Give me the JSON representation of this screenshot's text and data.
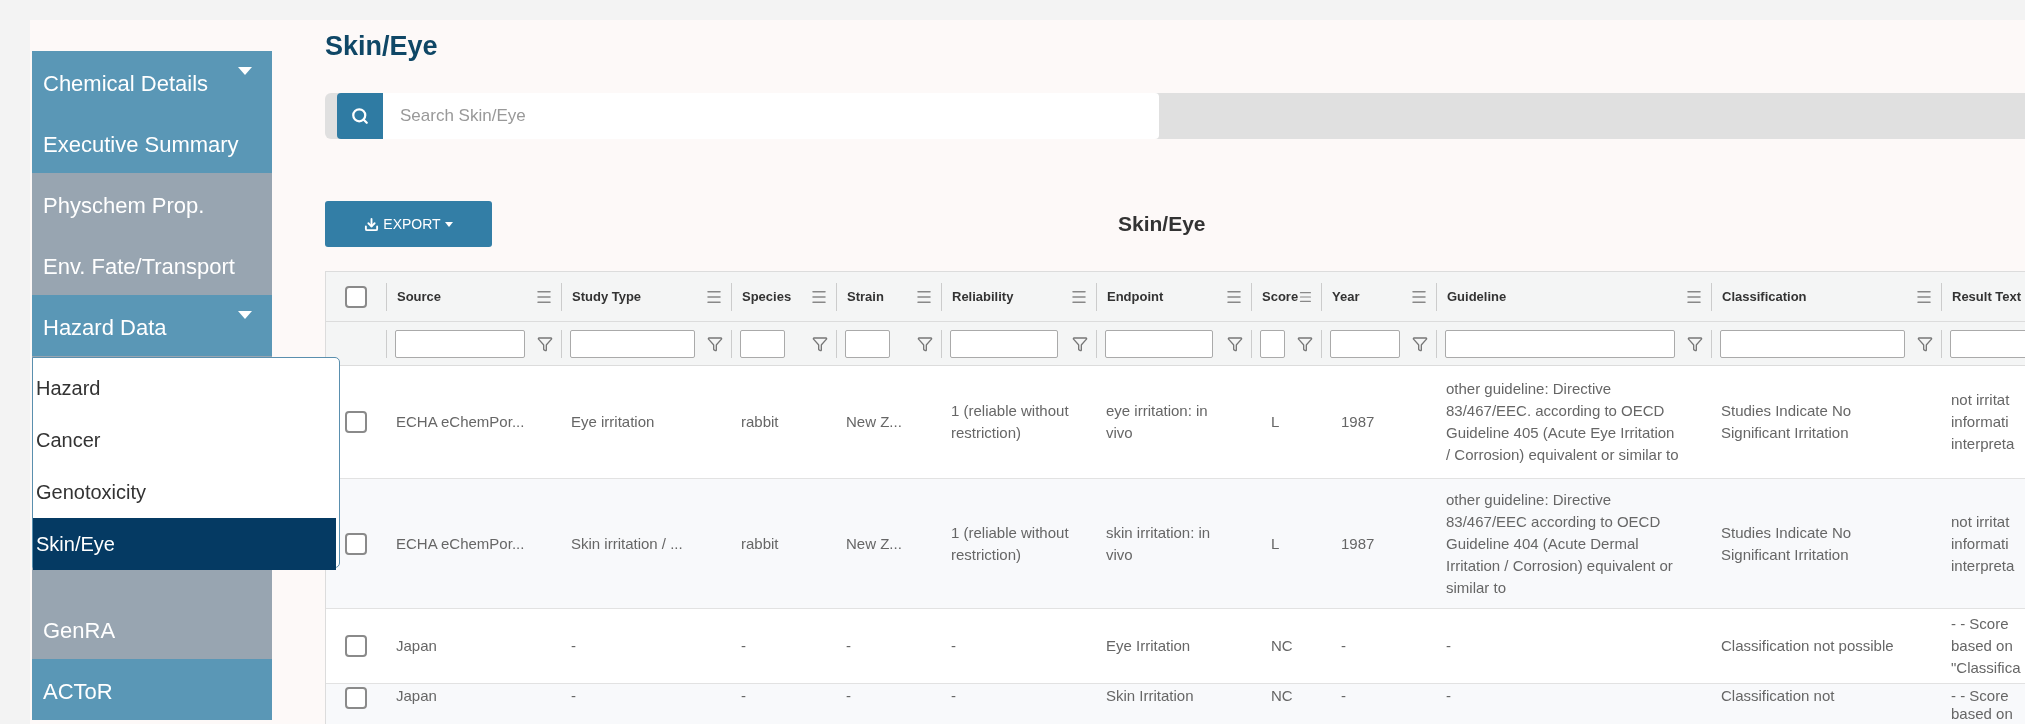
{
  "sidebar": {
    "items": [
      {
        "label": "Chemical Details",
        "disabled": false,
        "has_menu": true
      },
      {
        "label": "Executive Summary",
        "disabled": false,
        "has_menu": false
      },
      {
        "label": "Physchem Prop.",
        "disabled": true,
        "has_menu": false
      },
      {
        "label": "Env. Fate/Transport",
        "disabled": true,
        "has_menu": false
      },
      {
        "label": "Hazard Data",
        "disabled": false,
        "has_menu": true
      },
      {
        "label": "GenRA",
        "disabled": true,
        "has_menu": false
      },
      {
        "label": "ACToR",
        "disabled": false,
        "has_menu": false
      }
    ]
  },
  "dropdown": {
    "items": [
      {
        "label": "Hazard",
        "selected": false
      },
      {
        "label": "Cancer",
        "selected": false
      },
      {
        "label": "Genotoxicity",
        "selected": false
      },
      {
        "label": "Skin/Eye",
        "selected": true
      }
    ]
  },
  "page_title": "Skin/Eye",
  "search": {
    "placeholder": "Search Skin/Eye"
  },
  "export_button": "EXPORT",
  "table": {
    "title": "Skin/Eye",
    "select_all_checked": false,
    "columns": [
      "Source",
      "Study Type",
      "Species",
      "Strain",
      "Reliability",
      "Endpoint",
      "Score",
      "Year",
      "Guideline",
      "Classification",
      "Result Text"
    ],
    "rows": [
      {
        "checked": false,
        "cells": [
          "ECHA eChemPor...",
          "Eye irritation",
          "rabbit",
          "New Z...",
          "1 (reliable without restriction)",
          "eye irritation: in vivo",
          "L",
          "1987",
          "other guideline: Directive 83/467/EEC. according to OECD Guideline 405 (Acute Eye Irritation / Corrosion) equivalent or similar to",
          "Studies Indicate No Significant Irritation",
          "not irritat\ninformati\ninterpreta"
        ]
      },
      {
        "checked": false,
        "cells": [
          "ECHA eChemPor...",
          "Skin irritation / ...",
          "rabbit",
          "New Z...",
          "1 (reliable without restriction)",
          "skin irritation: in vivo",
          "L",
          "1987",
          "other guideline: Directive 83/467/EEC according to OECD Guideline 404 (Acute Dermal Irritation / Corrosion) equivalent or similar to",
          "Studies Indicate No Significant Irritation",
          "not irritat\ninformati\ninterpreta"
        ]
      },
      {
        "checked": false,
        "cells": [
          "Japan",
          "-",
          "-",
          "-",
          "-",
          "Eye Irritation",
          "NC",
          "-",
          "-",
          "Classification not possible",
          "- - Score\nbased on\n\"Classifica"
        ]
      },
      {
        "checked": false,
        "cells": [
          "Japan",
          "-",
          "-",
          "-",
          "-",
          "Skin Irritation",
          "NC",
          "-",
          "-",
          "Classification not",
          "- - Score\nbased on"
        ]
      }
    ]
  }
}
